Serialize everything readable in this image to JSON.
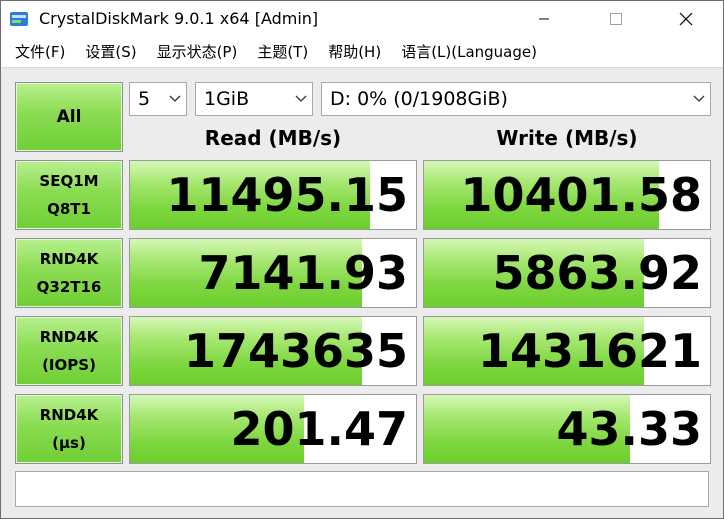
{
  "window": {
    "title": "CrystalDiskMark 9.0.1 x64 [Admin]",
    "icon": "crystaldiskmark-app-icon"
  },
  "menu": {
    "items": [
      "文件(F)",
      "设置(S)",
      "显示状态(P)",
      "主题(T)",
      "帮助(H)",
      "语言(L)(Language)"
    ]
  },
  "controls": {
    "all_label": "All",
    "count": "5",
    "size": "1GiB",
    "drive": "D: 0% (0/1908GiB)"
  },
  "headers": {
    "read": "Read (MB/s)",
    "write": "Write (MB/s)"
  },
  "rows": [
    {
      "line1": "SEQ1M",
      "line2": "Q8T1",
      "read": "11495.15",
      "write": "10401.58",
      "read_fill": 0.84,
      "write_fill": 0.82
    },
    {
      "line1": "RND4K",
      "line2": "Q32T16",
      "read": "7141.93",
      "write": "5863.92",
      "read_fill": 0.81,
      "write_fill": 0.77
    },
    {
      "line1": "RND4K",
      "line2": "(IOPS)",
      "read": "1743635",
      "write": "1431621",
      "read_fill": 0.81,
      "write_fill": 0.77
    },
    {
      "line1": "RND4K",
      "line2": "(μs)",
      "read": "201.47",
      "write": "43.33",
      "read_fill": 0.61,
      "write_fill": 0.72
    }
  ],
  "status_text": "",
  "colors": {
    "accent_green": "#6fcf35",
    "panel_bg": "#ececec"
  }
}
